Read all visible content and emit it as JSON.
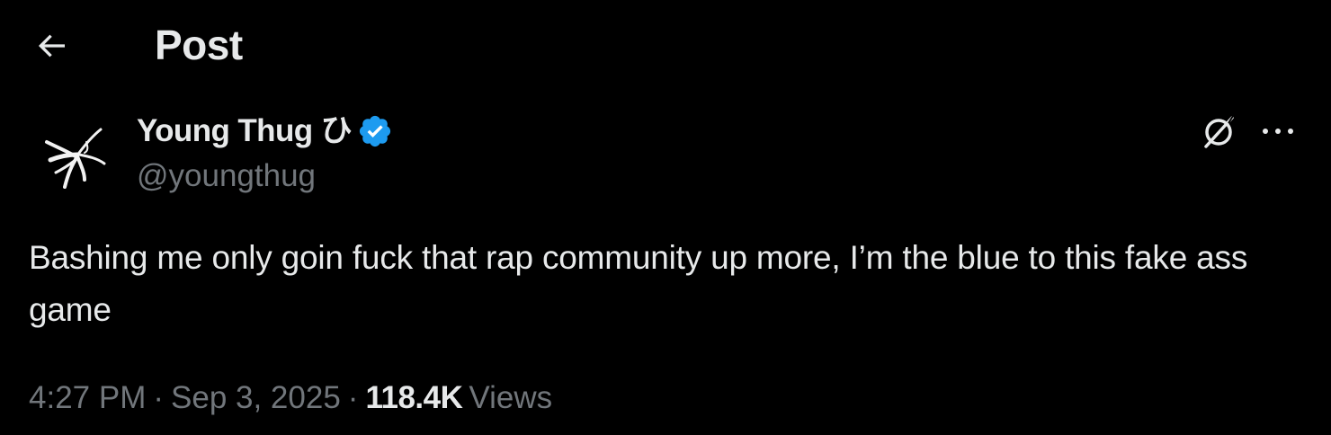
{
  "header": {
    "title": "Post",
    "back_icon": "arrow-left-icon"
  },
  "author": {
    "display_name": "Young Thug ひ",
    "handle": "@youngthug",
    "verified_color": "#1d9bf0",
    "avatar_icon": "avatar-glyph-icon"
  },
  "actions": {
    "grok_icon": "grok-icon",
    "more_icon": "more-horizontal-icon"
  },
  "tweet": {
    "text": "Bashing me only goin fuck that rap community up more, I’m the blue to this fake ass game"
  },
  "meta": {
    "time": "4:27 PM",
    "separator": "·",
    "date": "Sep 3, 2025",
    "views_count": "118.4K",
    "views_label": "Views"
  },
  "colors": {
    "background": "#000000",
    "primary_text": "#e7e9ea",
    "secondary_text": "#71767b",
    "accent": "#1d9bf0"
  }
}
